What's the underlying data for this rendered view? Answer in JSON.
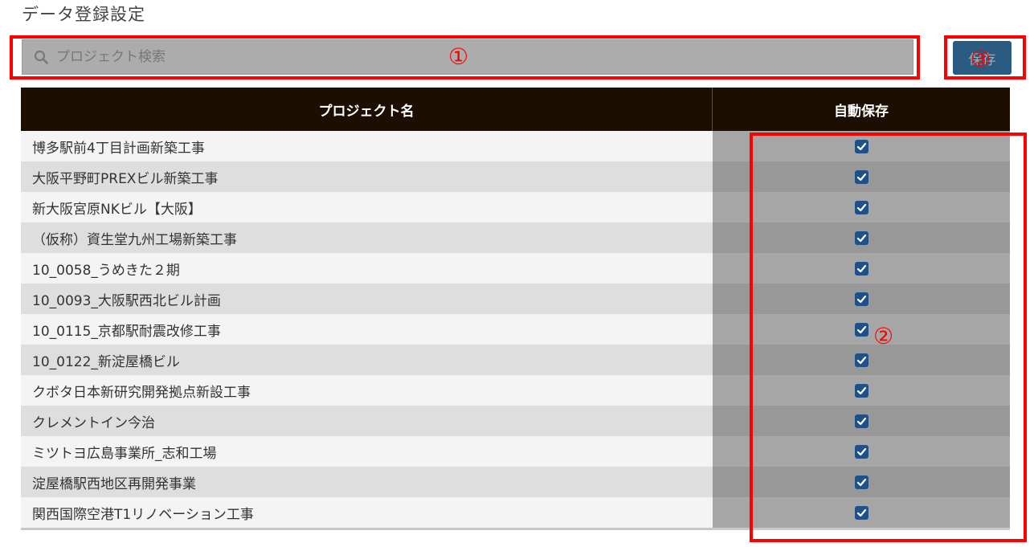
{
  "page": {
    "title": "データ登録設定"
  },
  "search": {
    "placeholder": "プロジェクト検索"
  },
  "toolbar": {
    "save_label": "保存"
  },
  "annotations": {
    "marker_1": "①",
    "marker_2": "②",
    "marker_3": "③"
  },
  "table": {
    "headers": {
      "name": "プロジェクト名",
      "auto_save": "自動保存"
    },
    "rows": [
      {
        "name": "博多駅前4丁目計画新築工事",
        "auto_save": true
      },
      {
        "name": "大阪平野町PREXビル新築工事",
        "auto_save": true
      },
      {
        "name": "新大阪宮原NKビル【大阪】",
        "auto_save": true
      },
      {
        "name": "（仮称）資生堂九州工場新築工事",
        "auto_save": true
      },
      {
        "name": "10_0058_うめきた２期",
        "auto_save": true
      },
      {
        "name": "10_0093_大阪駅西北ビル計画",
        "auto_save": true
      },
      {
        "name": "10_0115_京都駅耐震改修工事",
        "auto_save": true
      },
      {
        "name": "10_0122_新淀屋橋ビル",
        "auto_save": true
      },
      {
        "name": "クボタ日本新研究開発拠点新設工事",
        "auto_save": true
      },
      {
        "name": "クレメントイン今治",
        "auto_save": true
      },
      {
        "name": "ミツトヨ広島事業所_志和工場",
        "auto_save": true
      },
      {
        "name": "淀屋橋駅西地区再開発事業",
        "auto_save": true
      },
      {
        "name": "関西国際空港T1リノベーション工事",
        "auto_save": true
      }
    ]
  },
  "colors": {
    "header_bg": "#1c0f02",
    "checkbox": "#1f5188",
    "save_button": "#2a5b83",
    "annotation": "#ff0000"
  },
  "icons": {
    "search": "search-icon",
    "checkbox_checked": "checkmark-icon"
  }
}
